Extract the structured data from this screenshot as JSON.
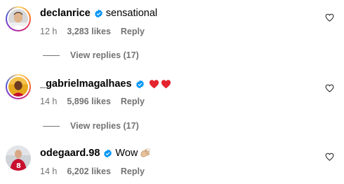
{
  "comments": [
    {
      "username": "declanrice",
      "text": "sensational",
      "time": "12 h",
      "likes": "3,283 likes",
      "reply": "Reply",
      "view_replies": "View replies (17)",
      "emoji": []
    },
    {
      "username": "_gabrielmagalhaes",
      "text": "",
      "time": "14 h",
      "likes": "5,896 likes",
      "reply": "Reply",
      "view_replies": "View replies (17)",
      "emoji": [
        "red-heart",
        "red-heart"
      ]
    },
    {
      "username": "odegaard.98",
      "text": "Wow",
      "time": "14 h",
      "likes": "6,202 likes",
      "reply": "Reply",
      "emoji": [
        "clapping-hands"
      ]
    }
  ],
  "colors": {
    "verified_blue": "#0095f6",
    "meta_gray": "#737373",
    "emoji_red": "#e4242e",
    "clap_tone": "#e8c29a"
  }
}
